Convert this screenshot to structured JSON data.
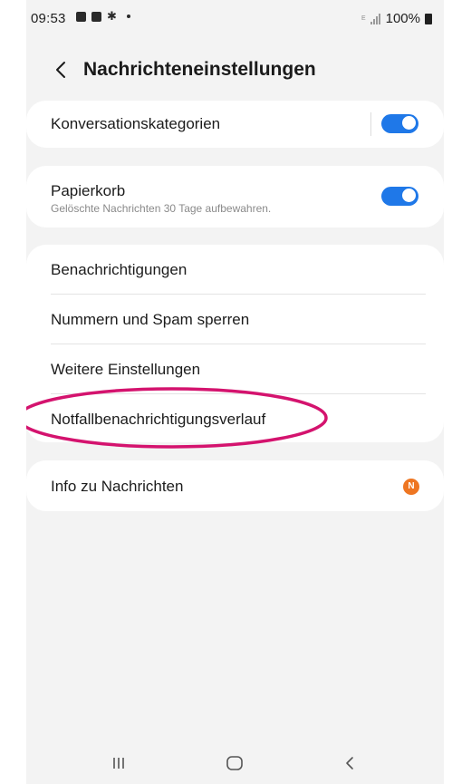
{
  "status_bar": {
    "time": "09:53",
    "battery": "100%",
    "network_label": "E"
  },
  "header": {
    "title": "Nachrichteneinstellungen"
  },
  "settings": {
    "conversation_categories": {
      "label": "Konversationskategorien",
      "enabled": true
    },
    "trash": {
      "label": "Papierkorb",
      "description": "Gelöschte Nachrichten 30 Tage aufbewahren.",
      "enabled": true
    },
    "menu_items": [
      {
        "label": "Benachrichtigungen"
      },
      {
        "label": "Nummern und Spam sperren"
      },
      {
        "label": "Weitere Einstellungen"
      },
      {
        "label": "Notfallbenachrichtigungsverlauf"
      }
    ],
    "about": {
      "label": "Info zu Nachrichten",
      "badge": "N"
    }
  },
  "colors": {
    "accent": "#1f78e8",
    "badge": "#ee7622",
    "highlight": "#d4136e",
    "background": "#f3f3f3"
  },
  "icons": {
    "back": "chevron-left-icon",
    "nav_recents": "recent-apps-icon",
    "nav_home": "home-icon",
    "nav_back": "back-icon"
  }
}
